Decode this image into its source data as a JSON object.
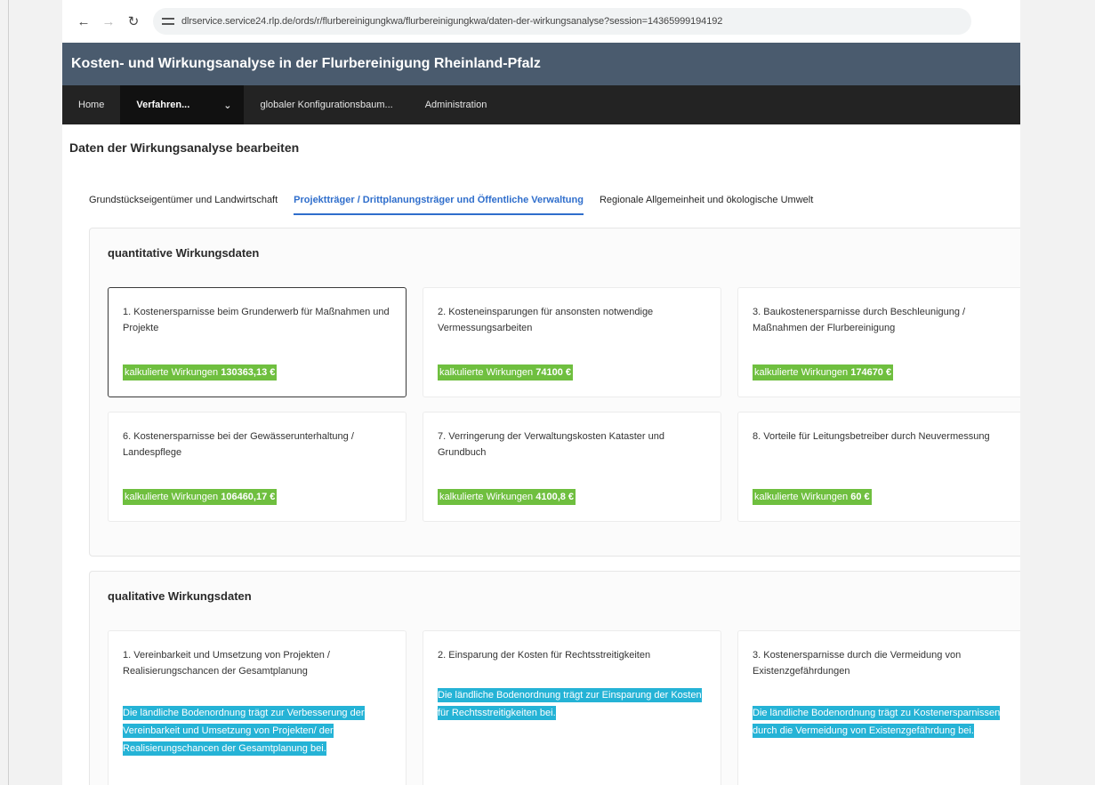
{
  "browser": {
    "url": "dlrservice.service24.rlp.de/ords/r/flurbereinigungkwa/flurbereinigungkwa/daten-der-wirkungsanalyse?session=14365999194192",
    "back_icon": "arrow-left",
    "forward_icon": "arrow-right",
    "reload_icon": "reload"
  },
  "app": {
    "title": "Kosten- und Wirkungsanalyse in der Flurbereinigung Rheinland-Pfalz",
    "header_color": "#4a5b6e"
  },
  "menu": {
    "items": [
      {
        "label": "Home"
      },
      {
        "label": "Verfahren..."
      },
      {
        "label": "globaler Konfigurationsbaum..."
      },
      {
        "label": "Administration"
      }
    ]
  },
  "page": {
    "title": "Daten der Wirkungsanalyse bearbeiten"
  },
  "tabs": [
    {
      "label": "Grundstückseigentümer und Landwirtschaft",
      "active": false
    },
    {
      "label": "Projektträger / Drittplanungsträger und Öffentliche Verwaltung",
      "active": true
    },
    {
      "label": "Regionale Allgemeinheit und ökologische Umwelt",
      "active": false
    }
  ],
  "quantitative": {
    "heading": "quantitative Wirkungsdaten",
    "calc_prefix": "kalkulierte Wirkungen",
    "cards": [
      {
        "label": "1. Kostenersparnisse beim Grunderwerb für Maßnahmen und Projekte",
        "value": "130363,13 €"
      },
      {
        "label": "2. Kosteneinsparungen für ansonsten notwendige Vermessungsarbeiten",
        "value": "74100 €"
      },
      {
        "label": "3. Baukostenersparnisse durch Beschleunigung / Maßnahmen der Flurbereinigung",
        "value": "174670 €"
      },
      {
        "label": "6. Kostenersparnisse bei der Gewässerunterhaltung / Landespflege",
        "value": "106460,17 €"
      },
      {
        "label": "7. Verringerung der Verwaltungskosten Kataster und Grundbuch",
        "value": "4100,8 €"
      },
      {
        "label": "8. Vorteile für Leitungsbetreiber durch Neuvermessung",
        "value": "60 €"
      }
    ]
  },
  "qualitative": {
    "heading": "qualitative Wirkungsdaten",
    "cards": [
      {
        "label": "1. Vereinbarkeit und Umsetzung von Projekten / Realisierungschancen der Gesamtplanung",
        "text": "Die ländliche Bodenordnung trägt zur Verbesserung der Vereinbarkeit und Umsetzung von Projekten/ der Realisierungschancen der Gesamtplanung bei."
      },
      {
        "label": "2. Einsparung der Kosten für Rechtsstreitigkeiten",
        "text": "Die ländliche Bodenordnung trägt zur Einsparung der Kosten für Rechtsstreitigkeiten bei."
      },
      {
        "label": "3. Kostenersparnisse durch die Vermeidung von Existenzgefährdungen",
        "text": "Die ländliche Bodenordnung trägt zu Kostenersparnissen durch die Vermeidung von Existenzgefährdung bei."
      }
    ]
  },
  "colors": {
    "calc_badge": "#6fbf3f",
    "quali_highlight": "#25b3d6",
    "active_tab": "#2f6ecc"
  }
}
